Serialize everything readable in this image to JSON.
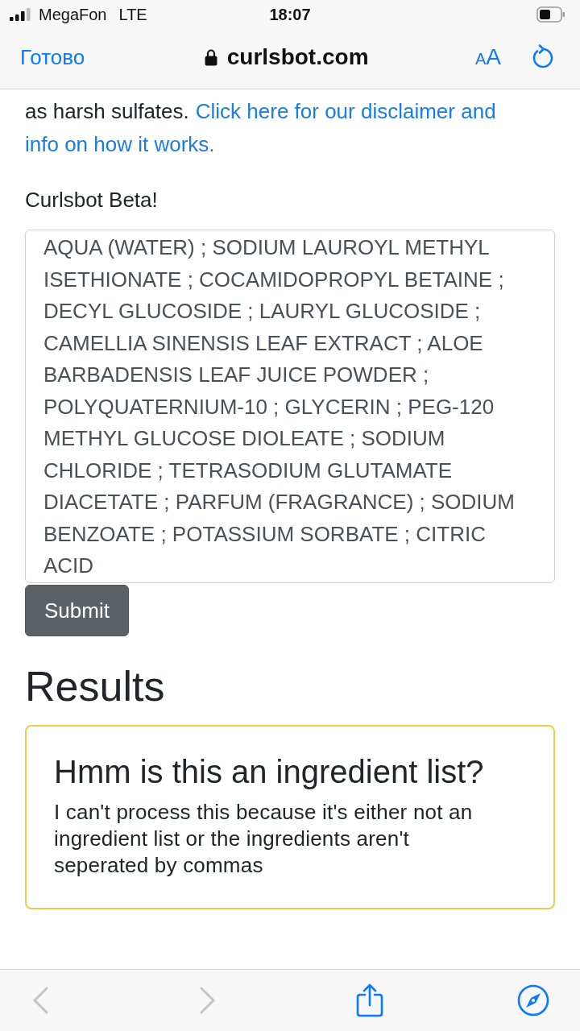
{
  "status_bar": {
    "carrier": "MegaFon",
    "network": "LTE",
    "time": "18:07"
  },
  "nav_bar": {
    "done": "Готово",
    "url": "curlsbot.com",
    "text_size": {
      "small": "A",
      "large": "A"
    }
  },
  "intro": {
    "text": "as harsh sulfates.",
    "link_lines": [
      "Click here for our disclaimer and",
      "info on how it works."
    ]
  },
  "form": {
    "label": "Curlsbot Beta!",
    "ingredients": "AQUA (WATER) ; SODIUM LAUROYL METHYL ISETHIONATE ; COCAMIDOPROPYL BETAINE ; DECYL GLUCOSIDE ; LAURYL GLUCOSIDE ; CAMELLIA SINENSIS LEAF EXTRACT ; ALOE BARBADENSIS LEAF JUICE POWDER ; POLYQUATERNIUM-10 ; GLYCERIN ; PEG-120 METHYL GLUCOSE DIOLEATE ; SODIUM CHLORIDE ; TETRASODIUM GLUTAMATE DIACETATE ; PARFUM (FRAGRANCE) ; SODIUM BENZOATE ; POTASSIUM SORBATE ; CITRIC ACID",
    "submit": "Submit"
  },
  "results": {
    "heading": "Results",
    "alert": {
      "title": "Hmm is this an ingredient list?",
      "message": "I can't process this because it's either not an ingredient list or the ingredients aren't seperated by commas"
    }
  },
  "toolbar": [
    {
      "kind": "back",
      "disabled": true
    },
    {
      "kind": "forward",
      "disabled": true
    },
    {
      "kind": "share",
      "disabled": false
    },
    {
      "kind": "compass",
      "disabled": false
    }
  ]
}
